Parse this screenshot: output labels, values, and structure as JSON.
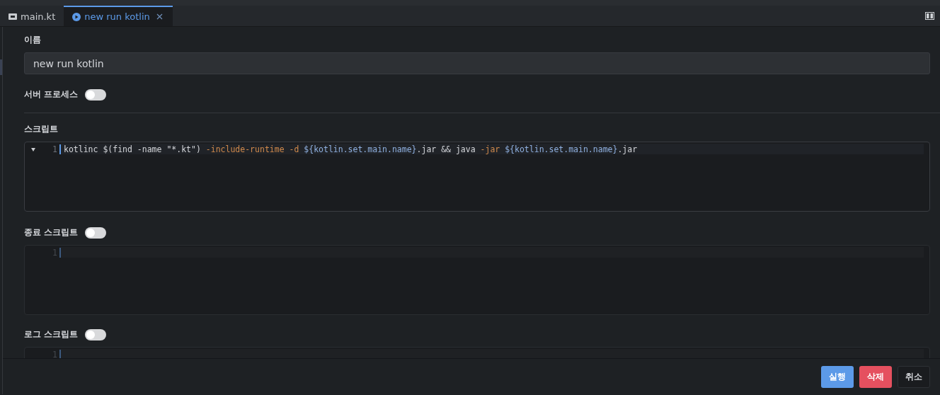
{
  "tabs": [
    {
      "label": "main.kt",
      "kind": "file",
      "selected": false,
      "closable": false
    },
    {
      "label": "new run kotlin",
      "kind": "run",
      "selected": true,
      "closable": true
    }
  ],
  "form": {
    "name_label": "이름",
    "name_value": "new run kotlin",
    "server_process": {
      "label": "서버 프로세스",
      "on": false
    },
    "script": {
      "label": "스크립트",
      "lines": [
        {
          "number": "1",
          "tokens": [
            {
              "kind": "plain",
              "text": "kotlinc $(find -name \"*.kt\") "
            },
            {
              "kind": "flag",
              "text": "-include-runtime -d "
            },
            {
              "kind": "var",
              "text": "${kotlin.set.main.name}"
            },
            {
              "kind": "plain",
              "text": ".jar && java "
            },
            {
              "kind": "flag",
              "text": "-jar "
            },
            {
              "kind": "var",
              "text": "${kotlin.set.main.name}"
            },
            {
              "kind": "plain",
              "text": ".jar"
            }
          ]
        }
      ]
    },
    "stop_script": {
      "label": "종료 스크립트",
      "on": false,
      "lines": [
        {
          "number": "1"
        }
      ]
    },
    "log_script": {
      "label": "로그 스크립트",
      "on": false,
      "lines": [
        {
          "number": "1"
        }
      ]
    }
  },
  "buttons": [
    {
      "label": "실행",
      "kind": "primary"
    },
    {
      "label": "삭제",
      "kind": "danger"
    },
    {
      "label": "취소",
      "kind": "default"
    }
  ]
}
